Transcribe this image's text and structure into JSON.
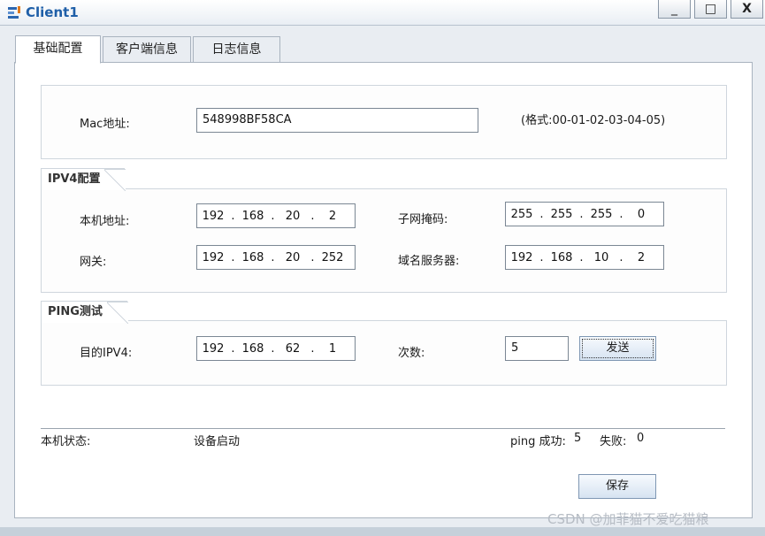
{
  "window": {
    "title": "Client1",
    "minimize": "_",
    "maximize": "□",
    "close": "X"
  },
  "tabs": [
    "基础配置",
    "客户端信息",
    "日志信息"
  ],
  "mac": {
    "label": "Mac地址:",
    "value": "548998BF58CA",
    "format_hint": "(格式:00-01-02-03-04-05)"
  },
  "ipv4": {
    "title": "IPV4配置",
    "local_address": {
      "label": "本机地址:",
      "octets": [
        "192",
        "168",
        "20",
        "2"
      ]
    },
    "subnet_mask": {
      "label": "子网掩码:",
      "octets": [
        "255",
        "255",
        "255",
        "0"
      ]
    },
    "gateway": {
      "label": "网关:",
      "octets": [
        "192",
        "168",
        "20",
        "252"
      ]
    },
    "dns": {
      "label": "域名服务器:",
      "octets": [
        "192",
        "168",
        "10",
        "2"
      ]
    }
  },
  "ping": {
    "title": "PING测试",
    "target": {
      "label": "目的IPV4:",
      "octets": [
        "192",
        "168",
        "62",
        "1"
      ]
    },
    "count": {
      "label": "次数:",
      "value": "5"
    },
    "send_label": "发送"
  },
  "status": {
    "label": "本机状态:",
    "value": "设备启动",
    "ping_success_label": "ping 成功:",
    "ping_success": "5",
    "ping_fail_label": "失败:",
    "ping_fail": "0"
  },
  "save_label": "保存",
  "watermark": "CSDN @加菲猫不爱吃猫粮"
}
